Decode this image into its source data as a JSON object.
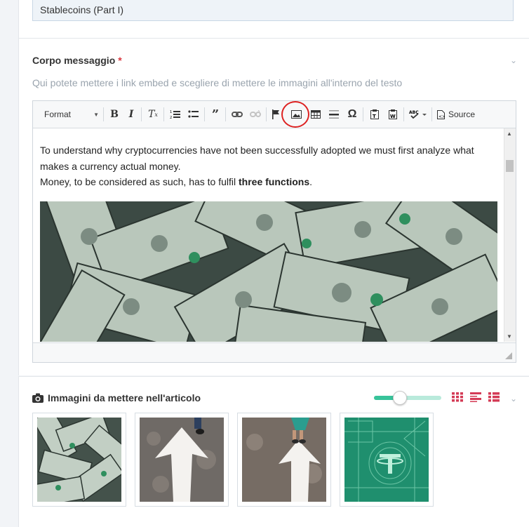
{
  "title_field": {
    "value": "Stablecoins (Part I)"
  },
  "body_field": {
    "label": "Corpo messaggio",
    "required_mark": "*",
    "help": "Qui potete mettere i link embed e scegliere di mettere le immagini all'interno del testo"
  },
  "toolbar": {
    "format_label": "Format",
    "source_label": "Source",
    "icons": [
      "bold-icon",
      "italic-icon",
      "remove-format-icon",
      "numbered-list-icon",
      "bulleted-list-icon",
      "blockquote-icon",
      "link-icon",
      "unlink-icon",
      "anchor-icon",
      "image-icon",
      "table-icon",
      "horizontal-rule-icon",
      "special-char-icon",
      "paste-text-icon",
      "paste-word-icon",
      "spellcheck-icon",
      "source-icon"
    ]
  },
  "content": {
    "para1": "To understand why cryptocurrencies have not been successfully adopted we must first analyze what makes a currency actual money.",
    "para2_start": "Money, to be considered as such, has to fulfil ",
    "para2_bold": "three functions",
    "para2_end": "."
  },
  "gallery": {
    "title": "Immagini da mettere nell'articolo",
    "slider_value": 0.35,
    "thumbnails": [
      "dollar-bills-image",
      "arrow-road-image-1",
      "arrow-road-image-2",
      "tether-logo-image"
    ]
  },
  "colors": {
    "required": "#d9363e",
    "accent_green": "#38c39a",
    "view_icon_red": "#d43b56",
    "annotation_red": "#dd2222"
  }
}
